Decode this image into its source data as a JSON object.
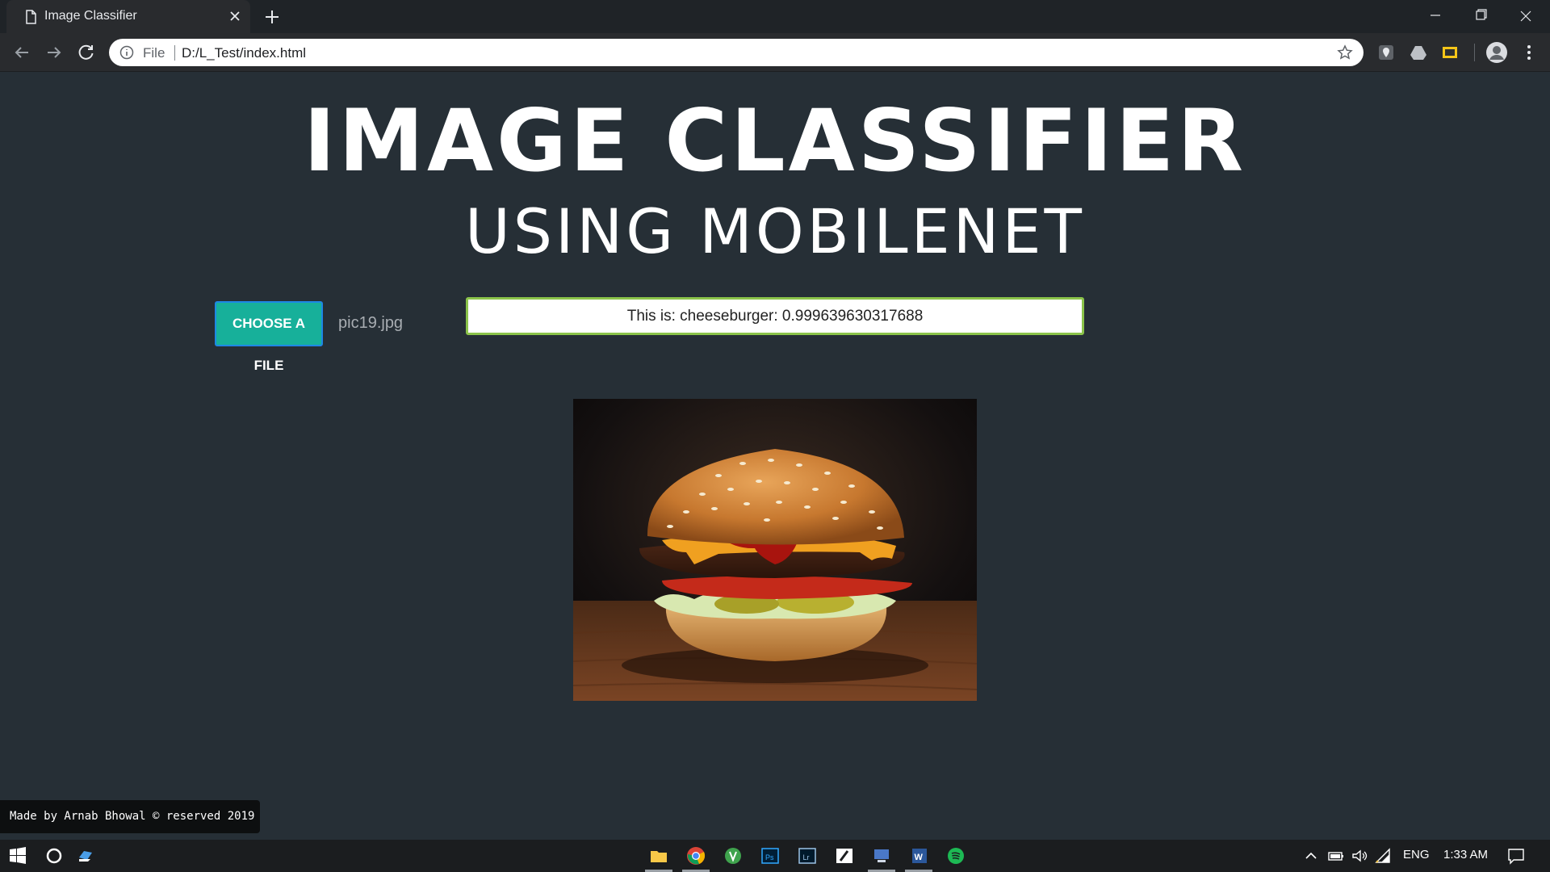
{
  "browser": {
    "tab_title": "Image Classifier",
    "omnibox_scheme": "File",
    "omnibox_url": "D:/L_Test/index.html"
  },
  "page": {
    "title": "IMAGE CLASSIFIER",
    "subtitle": "USING MOBILENET",
    "choose_button_label": "CHOOSE A FILE",
    "selected_file": "pic19.jpg",
    "result_text": "This is: cheeseburger: 0.999639630317688",
    "footer_text": "Made by Arnab Bhowal © reserved 2019"
  },
  "taskbar": {
    "language": "ENG",
    "clock": "1:33 AM"
  },
  "colors": {
    "page_bg": "#262f36",
    "button_bg": "#17b09a",
    "result_border": "#8bc34a"
  }
}
